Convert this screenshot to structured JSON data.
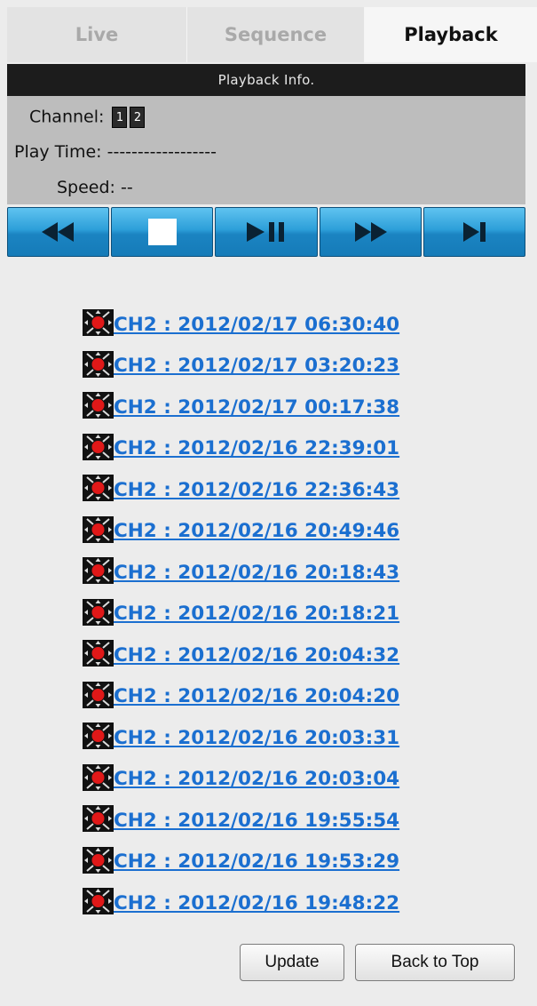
{
  "tabs": [
    {
      "label": "Live",
      "active": false
    },
    {
      "label": "Sequence",
      "active": false
    },
    {
      "label": "Playback",
      "active": true
    }
  ],
  "info": {
    "header": "Playback Info.",
    "channel_label": "Channel:",
    "channels": [
      "1",
      "2"
    ],
    "play_time_label": "Play Time:",
    "play_time_value": "------------------",
    "speed_label": "Speed:",
    "speed_value": "--"
  },
  "controls": [
    {
      "name": "rewind-icon"
    },
    {
      "name": "stop-icon"
    },
    {
      "name": "play-pause-icon"
    },
    {
      "name": "fast-forward-icon"
    },
    {
      "name": "next-frame-icon"
    }
  ],
  "records": [
    "CH2 : 2012/02/17 06:30:40",
    "CH2 : 2012/02/17 03:20:23",
    "CH2 : 2012/02/17 00:17:38",
    "CH2 : 2012/02/16 22:39:01",
    "CH2 : 2012/02/16 22:36:43",
    "CH2 : 2012/02/16 20:49:46",
    "CH2 : 2012/02/16 20:18:43",
    "CH2 : 2012/02/16 20:18:21",
    "CH2 : 2012/02/16 20:04:32",
    "CH2 : 2012/02/16 20:04:20",
    "CH2 : 2012/02/16 20:03:31",
    "CH2 : 2012/02/16 20:03:04",
    "CH2 : 2012/02/16 19:55:54",
    "CH2 : 2012/02/16 19:53:29",
    "CH2 : 2012/02/16 19:48:22"
  ],
  "buttons": {
    "update": "Update",
    "back_to_top": "Back to Top"
  },
  "colors": {
    "link": "#1b6fd0",
    "control_blue": "#2d9fd9",
    "header_dark": "#1c1c1c",
    "panel_gray": "#bdbdbd"
  }
}
